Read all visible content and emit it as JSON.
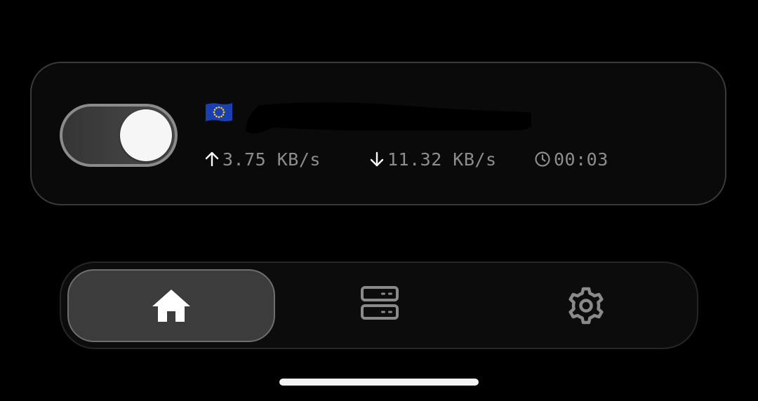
{
  "connection": {
    "enabled": true,
    "server": {
      "flag_icon": "eu-flag-icon",
      "name": ""
    },
    "upload_speed": "3.75 KB/s",
    "download_speed": "11.32 KB/s",
    "duration": "00:03"
  },
  "nav": {
    "tabs": [
      {
        "label": "",
        "icon": "home-icon",
        "active": true
      },
      {
        "label": "",
        "icon": "server-icon",
        "active": false
      },
      {
        "label": "",
        "icon": "gear-icon",
        "active": false
      }
    ]
  },
  "colors": {
    "background": "#000000",
    "card_background": "#0a0a0a",
    "card_border": "#3a3a3a",
    "stat_text": "#8d8d8d",
    "active_tab": "#3c3c3c",
    "icon_active": "#ffffff",
    "icon_inactive": "#8a8a8a"
  }
}
